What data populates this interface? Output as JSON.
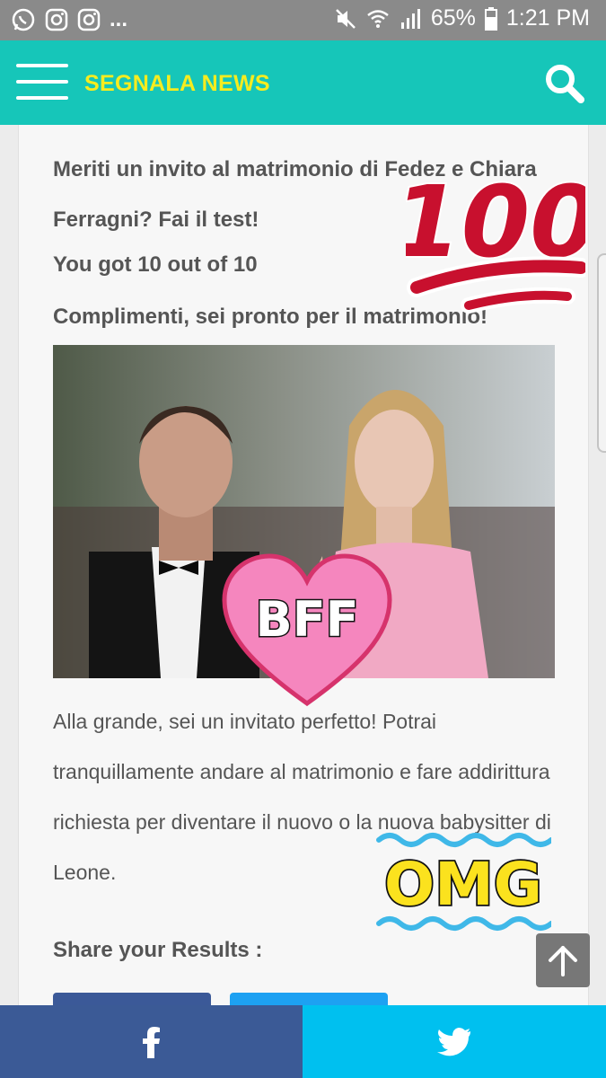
{
  "status_bar": {
    "overflow": "...",
    "battery": "65%",
    "time": "1:21 PM",
    "left_icons": [
      "whatsapp-icon",
      "instagram-icon",
      "instagram-icon"
    ],
    "right_icons": [
      "mute-icon",
      "wifi-icon",
      "signal-icon",
      "battery-icon"
    ]
  },
  "header": {
    "brand": "SEGNALA NEWS",
    "brand_color": "#f6ec1f",
    "background": "#16c6b9",
    "menu_icon": "hamburger-icon",
    "search_icon": "search-icon"
  },
  "quiz": {
    "title": "Meriti un invito al matrimonio di Fedez e Chiara Ferragni? Fai il test!",
    "score": "You got 10 out of 10",
    "result_title": "Complimenti, sei pronto per il matrimonio!",
    "result_text": "Alla grande, sei un invitato perfetto! Potrai tranquillamente andare al matrimonio e fare addirittura richiesta per diventare il nuovo o la nuova babysitter di Leone.",
    "share_label": "Share your Results :"
  },
  "stickers": {
    "hundred": "100",
    "bff": "BFF",
    "omg": "OMG"
  },
  "share_bar": {
    "facebook_icon": "facebook-icon",
    "twitter_icon": "twitter-icon",
    "facebook_color": "#3b5a96",
    "twitter_color": "#00c0ef"
  },
  "scroll_top_icon": "arrow-up-icon"
}
